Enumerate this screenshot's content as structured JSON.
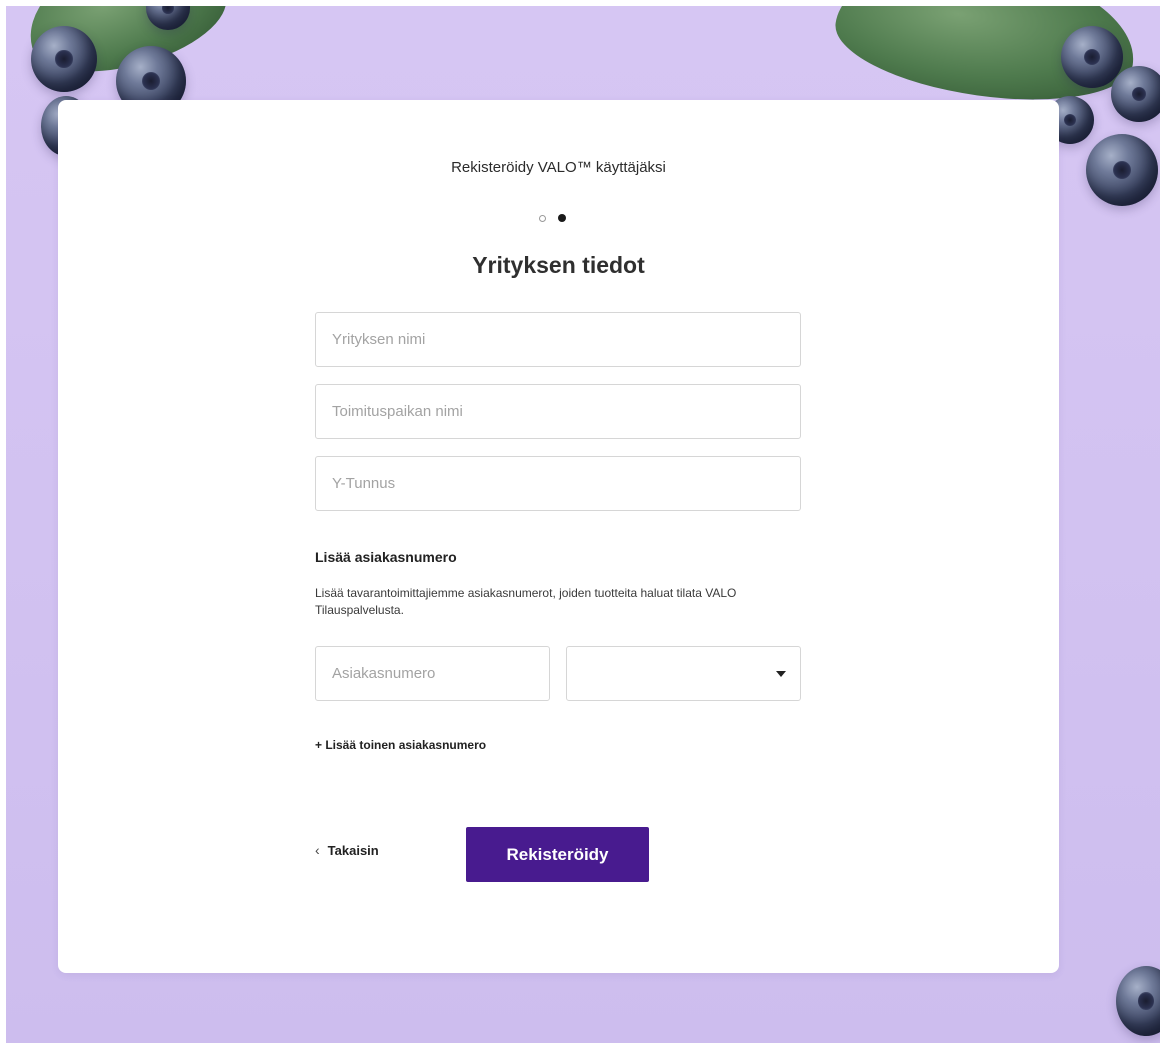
{
  "header": {
    "subtitle": "Rekisteröidy VALO™ käyttäjäksi",
    "steps": {
      "total": 2,
      "current": 2
    },
    "title": "Yrityksen tiedot"
  },
  "form": {
    "company_name_placeholder": "Yrityksen nimi",
    "delivery_place_placeholder": "Toimituspaikan nimi",
    "business_id_placeholder": "Y-Tunnus"
  },
  "customer_numbers": {
    "title": "Lisää asiakasnumero",
    "description": "Lisää tavarantoimittajiemme asiakasnumerot, joiden tuotteita haluat tilata VALO Tilauspalvelusta.",
    "number_placeholder": "Asiakasnumero",
    "supplier_selected": "",
    "add_another_label": "+ Lisää toinen asiakasnumero"
  },
  "actions": {
    "back_label": "Takaisin",
    "submit_label": "Rekisteröidy"
  },
  "colors": {
    "background": "#d4c4f2",
    "primary": "#481b8f"
  }
}
